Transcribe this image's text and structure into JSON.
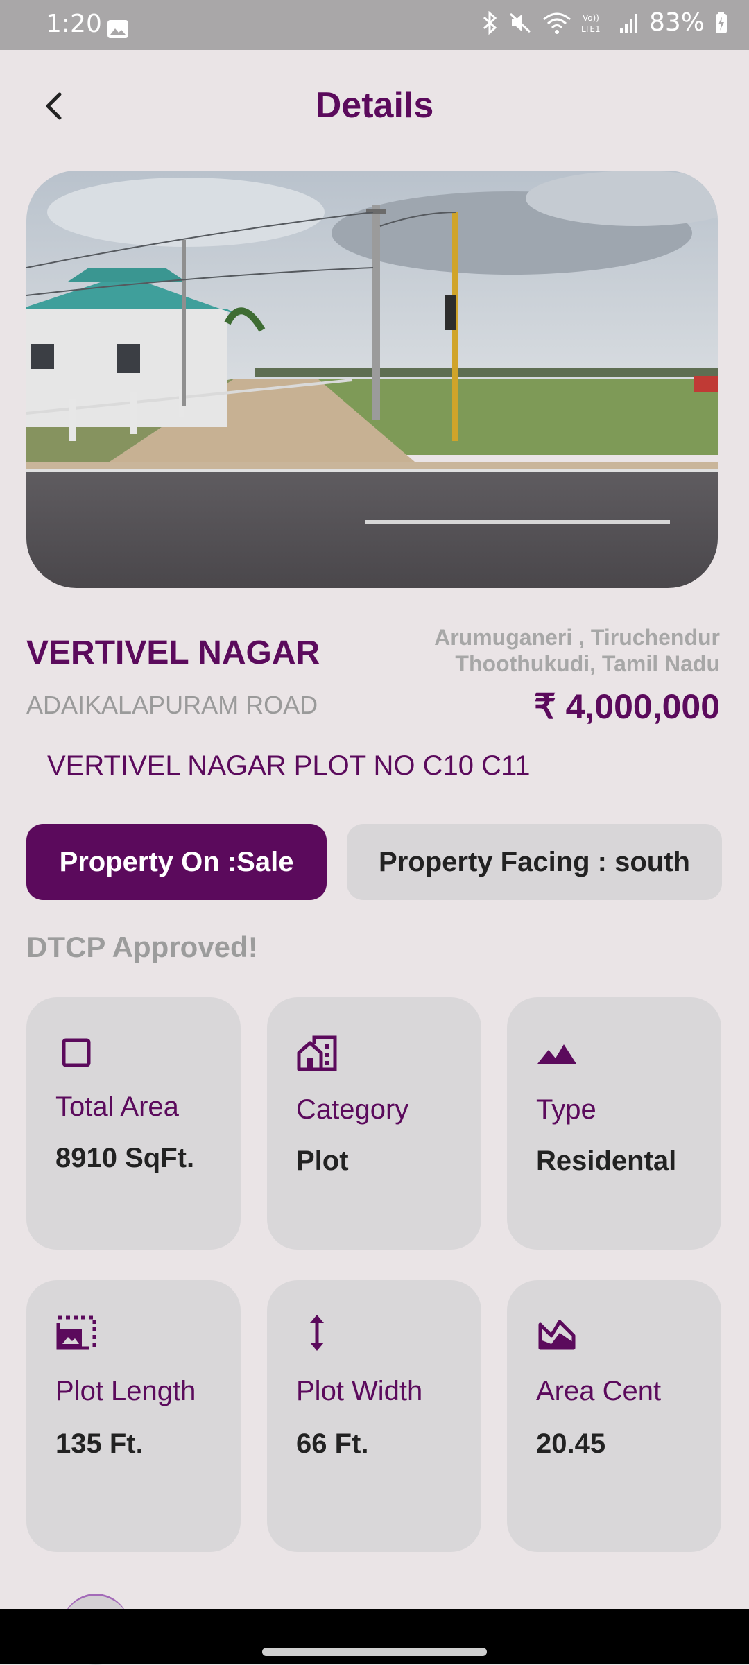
{
  "status": {
    "time": "1:20",
    "battery": "83%"
  },
  "header": {
    "title": "Details"
  },
  "property": {
    "name": "VERTIVEL NAGAR",
    "road": "ADAIKALAPURAM ROAD",
    "location_line1": "Arumuganeri , Tiruchendur",
    "location_line2": "Thoothukudi, Tamil Nadu",
    "price": "₹ 4,000,000",
    "plot_title": "VERTIVEL NAGAR PLOT NO C10 C11",
    "on_label": "Property On :Sale",
    "facing_label": "Property Facing : south",
    "approval": "DTCP Approved!"
  },
  "specs": [
    {
      "label": "Total Area",
      "value": "8910 SqFt.",
      "icon": "square-outline-icon"
    },
    {
      "label": "Category",
      "value": "Plot",
      "icon": "buildings-icon"
    },
    {
      "label": "Type",
      "value": "Residental",
      "icon": "landscape-icon"
    },
    {
      "label": "Plot Length",
      "value": "135 Ft.",
      "icon": "photo-size-icon"
    },
    {
      "label": "Plot Width",
      "value": "66 Ft.",
      "icon": "vertical-arrows-icon"
    },
    {
      "label": "Area Cent",
      "value": "20.45",
      "icon": "area-chart-icon"
    }
  ],
  "colors": {
    "brand": "#5B0A5C",
    "background": "#EAE4E6",
    "card": "#D9D7D9"
  }
}
